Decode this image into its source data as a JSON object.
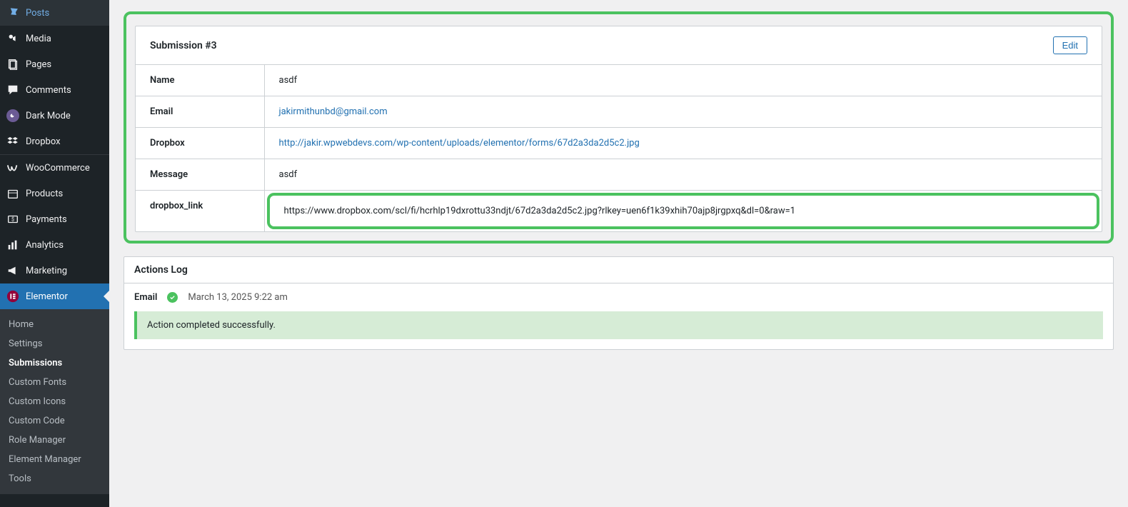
{
  "sidebar": {
    "items": [
      {
        "label": "Posts",
        "icon": "pin"
      },
      {
        "label": "Media",
        "icon": "media"
      },
      {
        "label": "Pages",
        "icon": "pages"
      },
      {
        "label": "Comments",
        "icon": "comments"
      },
      {
        "label": "Dark Mode",
        "icon": "darkmode"
      },
      {
        "label": "Dropbox",
        "icon": "dropbox"
      },
      {
        "label": "WooCommerce",
        "icon": "woo"
      },
      {
        "label": "Products",
        "icon": "products"
      },
      {
        "label": "Payments",
        "icon": "payments"
      },
      {
        "label": "Analytics",
        "icon": "analytics"
      },
      {
        "label": "Marketing",
        "icon": "marketing"
      },
      {
        "label": "Elementor",
        "icon": "elementor"
      }
    ],
    "submenu": [
      {
        "label": "Home"
      },
      {
        "label": "Settings"
      },
      {
        "label": "Submissions",
        "current": true
      },
      {
        "label": "Custom Fonts"
      },
      {
        "label": "Custom Icons"
      },
      {
        "label": "Custom Code"
      },
      {
        "label": "Role Manager"
      },
      {
        "label": "Element Manager"
      },
      {
        "label": "Tools"
      }
    ]
  },
  "submission": {
    "title": "Submission #3",
    "edit_label": "Edit",
    "fields": [
      {
        "label": "Name",
        "value": "asdf",
        "type": "text"
      },
      {
        "label": "Email",
        "value": "jakirmithunbd@gmail.com",
        "type": "link"
      },
      {
        "label": "Dropbox",
        "value": "http://jakir.wpwebdevs.com/wp-content/uploads/elementor/forms/67d2a3da2d5c2.jpg",
        "type": "link"
      },
      {
        "label": "Message",
        "value": "asdf",
        "type": "text"
      },
      {
        "label": "dropbox_link",
        "value": "https://www.dropbox.com/scl/fi/hcrhlp19dxrottu33ndjt/67d2a3da2d5c2.jpg?rlkey=uen6f1k39xhih70ajp8jrgpxq&dl=0&raw=1",
        "type": "text",
        "highlighted": true
      }
    ]
  },
  "actions_log": {
    "title": "Actions Log",
    "rows": [
      {
        "label": "Email",
        "status": "success",
        "time": "March 13, 2025 9:22 am",
        "message": "Action completed successfully."
      }
    ]
  }
}
